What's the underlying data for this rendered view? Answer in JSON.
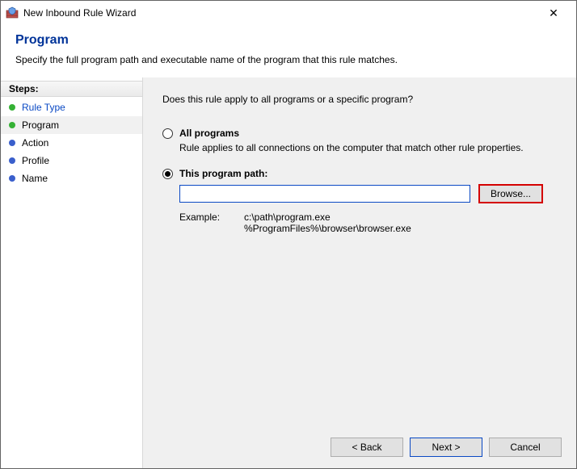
{
  "window": {
    "title": "New Inbound Rule Wizard"
  },
  "header": {
    "title": "Program",
    "subtitle": "Specify the full program path and executable name of the program that this rule matches."
  },
  "sidebar": {
    "label": "Steps:",
    "items": [
      {
        "label": "Rule Type",
        "state": "done",
        "link": true
      },
      {
        "label": "Program",
        "state": "current",
        "link": false
      },
      {
        "label": "Action",
        "state": "pending",
        "link": false
      },
      {
        "label": "Profile",
        "state": "pending",
        "link": false
      },
      {
        "label": "Name",
        "state": "pending",
        "link": false
      }
    ]
  },
  "main": {
    "question": "Does this rule apply to all programs or a specific program?",
    "options": {
      "all": {
        "label": "All programs",
        "desc": "Rule applies to all connections on the computer that match other rule properties.",
        "checked": false
      },
      "path": {
        "label": "This program path:",
        "checked": true,
        "input_value": "",
        "browse_label": "Browse...",
        "example_label": "Example:",
        "example_values": "c:\\path\\program.exe\n%ProgramFiles%\\browser\\browser.exe"
      }
    }
  },
  "footer": {
    "back": "< Back",
    "next": "Next >",
    "cancel": "Cancel"
  }
}
